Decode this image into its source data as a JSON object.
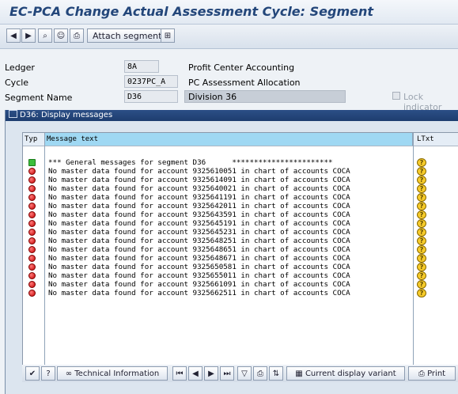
{
  "window": {
    "title": "EC-PCA Change Actual Assessment Cycle: Segment"
  },
  "toolbar": {
    "back_icon": "back-arrow-icon",
    "forward_icon": "forward-arrow-icon",
    "attach_segment_label": "Attach segment"
  },
  "fields": [
    {
      "label": "Ledger",
      "value": "8A",
      "description": "Profit Center Accounting"
    },
    {
      "label": "Cycle",
      "value": "0237PC_A",
      "description": "PC Assessment Allocation"
    },
    {
      "label": "Segment Name",
      "value": "D36",
      "description": "Division 36",
      "lock_label": "Lock indicator"
    }
  ],
  "dialog": {
    "title": "D36: Display messages",
    "columns": {
      "typ": "Typ",
      "message": "Message text",
      "ltxt": "LTxt"
    },
    "messages": [
      {
        "type": "success",
        "text": "*** General messages for segment D36      ***********************"
      },
      {
        "type": "error",
        "text": "No master data found for account 9325610051 in chart of accounts COCA"
      },
      {
        "type": "error",
        "text": "No master data found for account 9325614091 in chart of accounts COCA"
      },
      {
        "type": "error",
        "text": "No master data found for account 9325640021 in chart of accounts COCA"
      },
      {
        "type": "error",
        "text": "No master data found for account 9325641191 in chart of accounts COCA"
      },
      {
        "type": "error",
        "text": "No master data found for account 9325642011 in chart of accounts COCA"
      },
      {
        "type": "error",
        "text": "No master data found for account 9325643591 in chart of accounts COCA"
      },
      {
        "type": "error",
        "text": "No master data found for account 9325645191 in chart of accounts COCA"
      },
      {
        "type": "error",
        "text": "No master data found for account 9325645231 in chart of accounts COCA"
      },
      {
        "type": "error",
        "text": "No master data found for account 9325648251 in chart of accounts COCA"
      },
      {
        "type": "error",
        "text": "No master data found for account 9325648651 in chart of accounts COCA"
      },
      {
        "type": "error",
        "text": "No master data found for account 9325648671 in chart of accounts COCA"
      },
      {
        "type": "error",
        "text": "No master data found for account 9325650581 in chart of accounts COCA"
      },
      {
        "type": "error",
        "text": "No master data found for account 9325655011 in chart of accounts COCA"
      },
      {
        "type": "error",
        "text": "No master data found for account 9325661091 in chart of accounts COCA"
      },
      {
        "type": "error",
        "text": "No master data found for account 9325662511 in chart of accounts COCA"
      }
    ],
    "bottom_toolbar": {
      "technical_info_label": "Technical Information",
      "display_variant_label": "Current display variant",
      "print_label": "Print"
    }
  },
  "colors": {
    "title_text": "#23467a",
    "dialog_title_bg": "#1e3d6f",
    "header_highlight": "#9fd8f3"
  }
}
